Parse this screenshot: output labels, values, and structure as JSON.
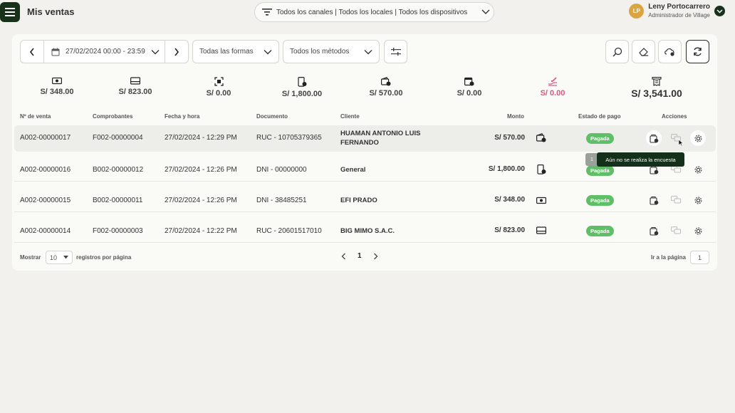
{
  "header": {
    "title": "Mis ventas",
    "filter_label": "Todos los canales | Todos los locales | Todos los dispositivos",
    "user": {
      "initials": "LP",
      "name": "Leny Portocarrero",
      "role": "Administrador de Village"
    }
  },
  "toolbar": {
    "date_range": "27/02/2024 00:00 - 23:59",
    "forms_select": "Todas las formas",
    "methods_select": "Todos los métodos"
  },
  "summary": [
    {
      "icon": "cash-icon",
      "value": "S/ 348.00"
    },
    {
      "icon": "card-icon",
      "value": "S/ 823.00"
    },
    {
      "icon": "qr-icon",
      "value": "S/ 0.00"
    },
    {
      "icon": "phone-pay-icon",
      "value": "S/ 1,800.00"
    },
    {
      "icon": "wallet-icon",
      "value": "S/ 570.00"
    },
    {
      "icon": "calendar-pay-icon",
      "value": "S/ 0.00"
    },
    {
      "icon": "credit-hand-icon",
      "value": "S/ 0.00",
      "color": "#d45a83"
    },
    {
      "icon": "receipt-icon",
      "value": "S/ 3,541.00"
    }
  ],
  "table": {
    "headers": {
      "sale_no": "Nº de venta",
      "voucher": "Comprobantes",
      "datetime": "Fecha y hora",
      "document": "Documento",
      "client": "Cliente",
      "amount": "Monto",
      "status": "Estado de pago",
      "actions": "Acciones"
    },
    "rows": [
      {
        "sale_no": "A002-00000017",
        "voucher": "F002-00000004",
        "datetime": "27/02/2024 - 12:29 PM",
        "document": "RUC - 10705379365",
        "client_l1": "HUAMAN ANTONIO LUIS",
        "client_l2": "FERNANDO",
        "amount": "S/ 570.00",
        "method_icon": "wallet-icon",
        "status": "Pagada"
      },
      {
        "sale_no": "A002-00000016",
        "voucher": "B002-00000012",
        "datetime": "27/02/2024 - 12:26 PM",
        "document": "DNI - 00000000",
        "client_l1": "General",
        "client_l2": "",
        "amount": "S/ 1,800.00",
        "method_icon": "phone-pay-icon",
        "status": "Pagada"
      },
      {
        "sale_no": "A002-00000015",
        "voucher": "B002-00000011",
        "datetime": "27/02/2024 - 12:26 PM",
        "document": "DNI - 38485251",
        "client_l1": "EFI PRADO",
        "client_l2": "",
        "amount": "S/ 348.00",
        "method_icon": "cash-icon",
        "status": "Pagada"
      },
      {
        "sale_no": "A002-00000014",
        "voucher": "F002-00000003",
        "datetime": "27/02/2024 - 12:22 PM",
        "document": "RUC - 20601517010",
        "client_l1": "BIG MIMO S.A.C.",
        "client_l2": "",
        "amount": "S/ 823.00",
        "method_icon": "card-icon",
        "status": "Pagada"
      }
    ],
    "tooltip": "Aún no se realiza la encuesta"
  },
  "footer": {
    "show_label": "Mostrar",
    "per_page": "10",
    "per_page_suffix": "registros por página",
    "current_page": "1",
    "goto_label": "Ir a la página",
    "goto_value": "1"
  },
  "colors": {
    "brand": "#17311b",
    "paid": "#5fbf67",
    "accent_pink": "#d45a83"
  }
}
